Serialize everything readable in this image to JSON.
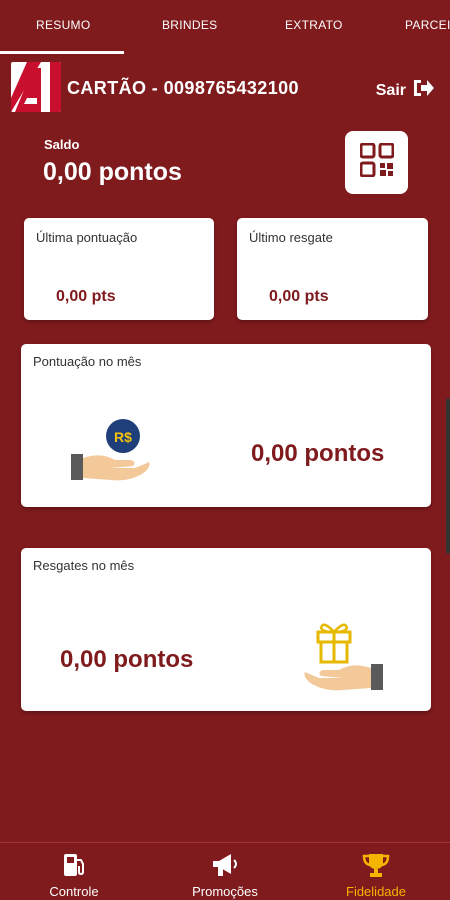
{
  "tabs": [
    "RESUMO",
    "BRINDES",
    "EXTRATO",
    "PARCEI"
  ],
  "header": {
    "card_title": "CARTÃO - 0098765432100",
    "logout_label": "Sair"
  },
  "saldo": {
    "label": "Saldo",
    "value": "0,00 pontos"
  },
  "last_score": {
    "label": "Última pontuação",
    "value": "0,00 pts"
  },
  "last_redeem": {
    "label": "Último resgate",
    "value": "0,00 pts"
  },
  "month_score": {
    "label": "Pontuação no mês",
    "value": "0,00 pontos",
    "coin_text": "R$"
  },
  "month_redeem": {
    "label": "Resgates no mês",
    "value": "0,00 pontos"
  },
  "nav": [
    {
      "label": "Controle",
      "icon": "fuel-pump-icon"
    },
    {
      "label": "Promoções",
      "icon": "megaphone-icon"
    },
    {
      "label": "Fidelidade",
      "icon": "trophy-icon"
    }
  ],
  "colors": {
    "background": "#7f1a1d",
    "accent": "#f4b400",
    "value_text": "#7f1a1d"
  }
}
